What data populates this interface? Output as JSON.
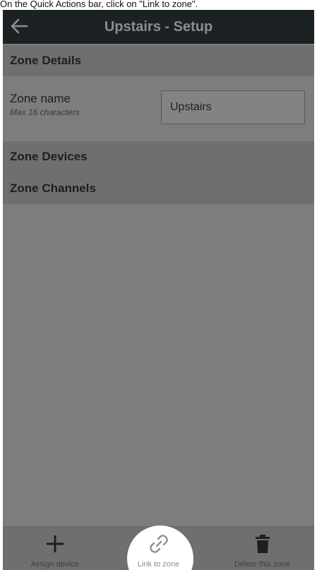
{
  "caption": "On the Quick Actions bar, click on \"Link to zone\".",
  "appbar": {
    "title": "Upstairs - Setup",
    "back_icon": "arrow-left-icon"
  },
  "sections": {
    "details": "Zone Details",
    "devices": "Zone Devices",
    "channels": "Zone Channels"
  },
  "zone_name": {
    "label": "Zone name",
    "hint": "Max 16 characters",
    "value": "Upstairs"
  },
  "quick_actions": [
    {
      "label": "Assign device",
      "icon": "plus-icon"
    },
    {
      "label": "Link to zone",
      "icon": "link-icon",
      "highlighted": true
    },
    {
      "label": "Delete this zone",
      "icon": "trash-icon"
    }
  ],
  "colors": {
    "appbar_bg": "#1c2223",
    "screen_overlay": "#7d7d7d",
    "highlight": "#ffffff"
  }
}
